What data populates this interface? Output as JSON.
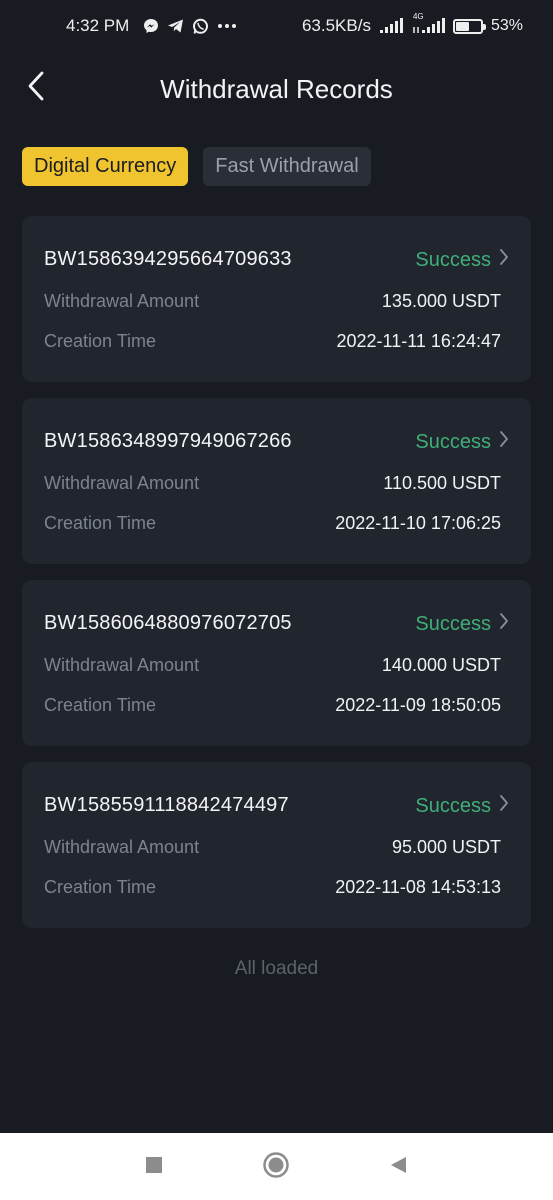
{
  "status_bar": {
    "time": "4:32 PM",
    "net_speed": "63.5KB/s",
    "net_type": "4G",
    "battery": "53%",
    "battery_level": 0.53,
    "icons": [
      "messenger-icon",
      "telegram-icon",
      "whatsapp-icon",
      "more-dots-icon"
    ]
  },
  "header": {
    "title": "Withdrawal Records",
    "back_icon": "chevron-left-icon"
  },
  "tabs": [
    {
      "label": "Digital Currency",
      "active": true
    },
    {
      "label": "Fast Withdrawal",
      "active": false
    }
  ],
  "records": [
    {
      "id": "BW1586394295664709633",
      "status": "Success",
      "amount_label": "Withdrawal Amount",
      "amount": "135.000 USDT",
      "time_label": "Creation Time",
      "time": "2022-11-11 16:24:47"
    },
    {
      "id": "BW1586348997949067266",
      "status": "Success",
      "amount_label": "Withdrawal Amount",
      "amount": "110.500 USDT",
      "time_label": "Creation Time",
      "time": "2022-11-10 17:06:25"
    },
    {
      "id": "BW1586064880976072705",
      "status": "Success",
      "amount_label": "Withdrawal Amount",
      "amount": "140.000 USDT",
      "time_label": "Creation Time",
      "time": "2022-11-09 18:50:05"
    },
    {
      "id": "BW1585591118842474497",
      "status": "Success",
      "amount_label": "Withdrawal Amount",
      "amount": "95.000 USDT",
      "time_label": "Creation Time",
      "time": "2022-11-08 14:53:13"
    }
  ],
  "footer_text": "All loaded",
  "colors": {
    "background": "#181b22",
    "card": "#21252d",
    "accent": "#f0c42f",
    "success": "#3fae79"
  },
  "nav_bar": {
    "icons": [
      "recents-square-icon",
      "home-circle-icon",
      "back-triangle-icon"
    ]
  }
}
